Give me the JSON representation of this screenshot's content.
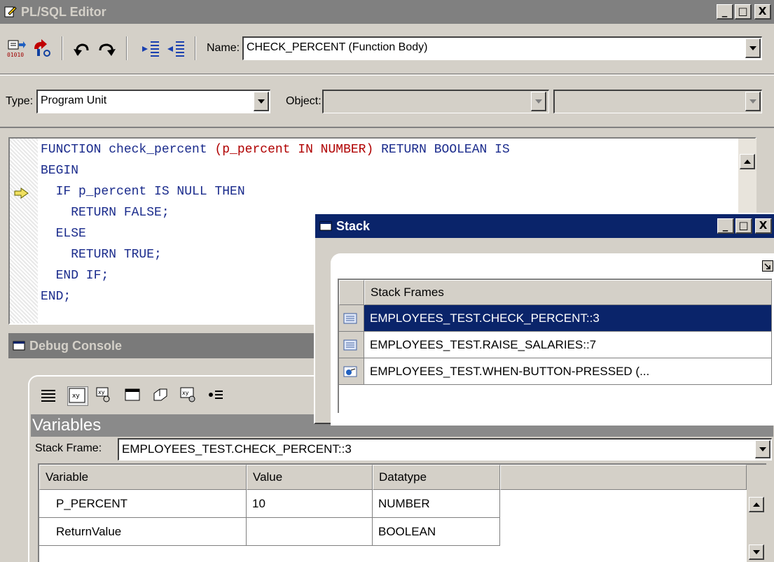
{
  "editor": {
    "title": "PL/SQL Editor",
    "name_label": "Name:",
    "name_value": "CHECK_PERCENT (Function Body)",
    "type_label": "Type:",
    "type_value": "Program Unit",
    "object_label": "Object:",
    "object_value_1": "",
    "object_value_2": "",
    "toolbar_icons": [
      "compile-icon",
      "run-icon",
      "undo-icon",
      "redo-icon",
      "indent-icon",
      "outdent-icon"
    ],
    "code_lines": [
      {
        "parts": [
          {
            "t": "FUNCTION check_percent ",
            "c": "kw"
          },
          {
            "t": "(p_percent IN NUMBER)",
            "c": "red"
          },
          {
            "t": " RETURN BOOLEAN IS",
            "c": "kw"
          }
        ]
      },
      {
        "parts": [
          {
            "t": "BEGIN",
            "c": "kw"
          }
        ]
      },
      {
        "parts": [
          {
            "t": "  IF p_percent IS NULL THEN",
            "c": "kw"
          }
        ]
      },
      {
        "parts": [
          {
            "t": "    RETURN FALSE;",
            "c": "kw"
          }
        ]
      },
      {
        "parts": [
          {
            "t": "  ELSE",
            "c": "kw"
          }
        ]
      },
      {
        "parts": [
          {
            "t": "    RETURN TRUE;",
            "c": "kw"
          }
        ]
      },
      {
        "parts": [
          {
            "t": "  END IF;",
            "c": "kw"
          }
        ]
      },
      {
        "parts": [
          {
            "t": "END;",
            "c": "kw"
          }
        ]
      }
    ],
    "current_line_index": 2
  },
  "stack": {
    "title": "Stack",
    "header": "Stack Frames",
    "frames": [
      {
        "label": "EMPLOYEES_TEST.CHECK_PERCENT::3",
        "selected": true,
        "icon": "program-unit-icon"
      },
      {
        "label": "EMPLOYEES_TEST.RAISE_SALARIES::7",
        "selected": false,
        "icon": "program-unit-icon"
      },
      {
        "label": "EMPLOYEES_TEST.WHEN-BUTTON-PRESSED (...",
        "selected": false,
        "icon": "trigger-icon"
      }
    ]
  },
  "debug": {
    "title": "Debug Console",
    "panel_title": "Variables",
    "stack_frame_label": "Stack Frame:",
    "stack_frame_value": "EMPLOYEES_TEST.CHECK_PERCENT::3",
    "columns": [
      "Variable",
      "Value",
      "Datatype"
    ],
    "rows": [
      {
        "variable": "P_PERCENT",
        "value": "10",
        "datatype": "NUMBER"
      },
      {
        "variable": "ReturnValue",
        "value": "",
        "datatype": "BOOLEAN"
      }
    ],
    "toolbar_icons": [
      "stack-icon",
      "variables-icon",
      "watch-icon",
      "form-values-icon",
      "global-values-icon",
      "pl-sql-packages-icon",
      "breakpoints-icon"
    ]
  },
  "window_buttons": {
    "minimize": "_",
    "maximize": "□",
    "close": "X"
  }
}
